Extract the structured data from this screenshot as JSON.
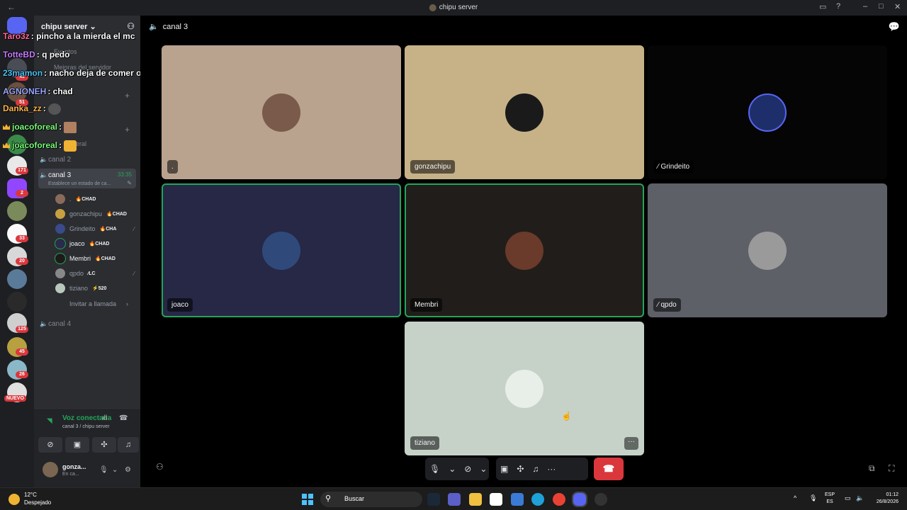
{
  "window": {
    "title": "chipu server",
    "back_icon": "←"
  },
  "server": {
    "name": "chipu server",
    "menu": [
      {
        "label": "Eventos"
      },
      {
        "label": "Mejoras del servidor"
      }
    ]
  },
  "channels": {
    "canal2": "canal 2",
    "canal3": "canal 3",
    "canal3_timer": "33:35",
    "canal3_status": "Establece un estado de ca...",
    "canal4": "canal 4",
    "general": "General"
  },
  "voice_members": [
    {
      "name": ".",
      "tag": "CHAD"
    },
    {
      "name": "gonzachipu",
      "tag": "CHAD"
    },
    {
      "name": "Grindeito",
      "tag": "CHA"
    },
    {
      "name": "joaco",
      "tag": "CHAD"
    },
    {
      "name": "Membri",
      "tag": "CHAD"
    },
    {
      "name": "qpdo",
      "tag": "LC"
    },
    {
      "name": "tiziano",
      "tag": "520"
    }
  ],
  "invite_label": "Invitar a llamada",
  "voice_panel": {
    "status": "Voz conectada",
    "location": "canal 3 / chipu server"
  },
  "user_panel": {
    "username": "gonza...",
    "status": "En ca..."
  },
  "server_badges": [
    "40",
    "51",
    "171",
    "2",
    "33",
    "20",
    "125",
    "45",
    "26"
  ],
  "server_new": "NUEVO",
  "chat": [
    {
      "user": "Taro3z",
      "message": ": pincho a la mierda el mc",
      "color": "#ff6b9d"
    },
    {
      "user": "TotteBD",
      "message": ": q pedo",
      "color": "#c77dff"
    },
    {
      "user": "23mamon",
      "message": ": nacho deja de comer oreja bo",
      "color": "#4fc3f7"
    },
    {
      "user": "AGNONEH",
      "message": ": chad",
      "color": "#9aa8ff"
    },
    {
      "user": "Danka_zz",
      "message": ":",
      "color": "#ffb74d"
    },
    {
      "user": "joacoforeal",
      "message": ":",
      "color": "#7cfc7c"
    },
    {
      "user": "joacoforeal",
      "message": ":",
      "color": "#7cfc7c"
    }
  ],
  "call": {
    "channel": "canal 3",
    "tiles": [
      {
        "name": ".",
        "bg": "#b9a38f",
        "speaking": false,
        "muted": false
      },
      {
        "name": "gonzachipu",
        "bg": "#c7b288",
        "speaking": false,
        "muted": false
      },
      {
        "name": "Grindeito",
        "bg": "#050505",
        "speaking": false,
        "muted": true
      },
      {
        "name": "joaco",
        "bg": "#272846",
        "speaking": true,
        "muted": false
      },
      {
        "name": "Membri",
        "bg": "#211d1a",
        "speaking": true,
        "muted": false
      },
      {
        "name": "qpdo",
        "bg": "#5e6068",
        "speaking": false,
        "muted": true
      },
      {
        "name": "tiziano",
        "bg": "#c6d2c8",
        "speaking": false,
        "muted": false
      }
    ]
  },
  "taskbar": {
    "temperature": "12°C",
    "condition": "Despejado",
    "search_placeholder": "Buscar",
    "lang_top": "ESP",
    "lang_bottom": "ES",
    "time": "01:12",
    "date": "26/8/2026"
  },
  "colors": {
    "accent_green": "#23a55a",
    "danger_red": "#da373c",
    "blurple": "#5865f2"
  }
}
